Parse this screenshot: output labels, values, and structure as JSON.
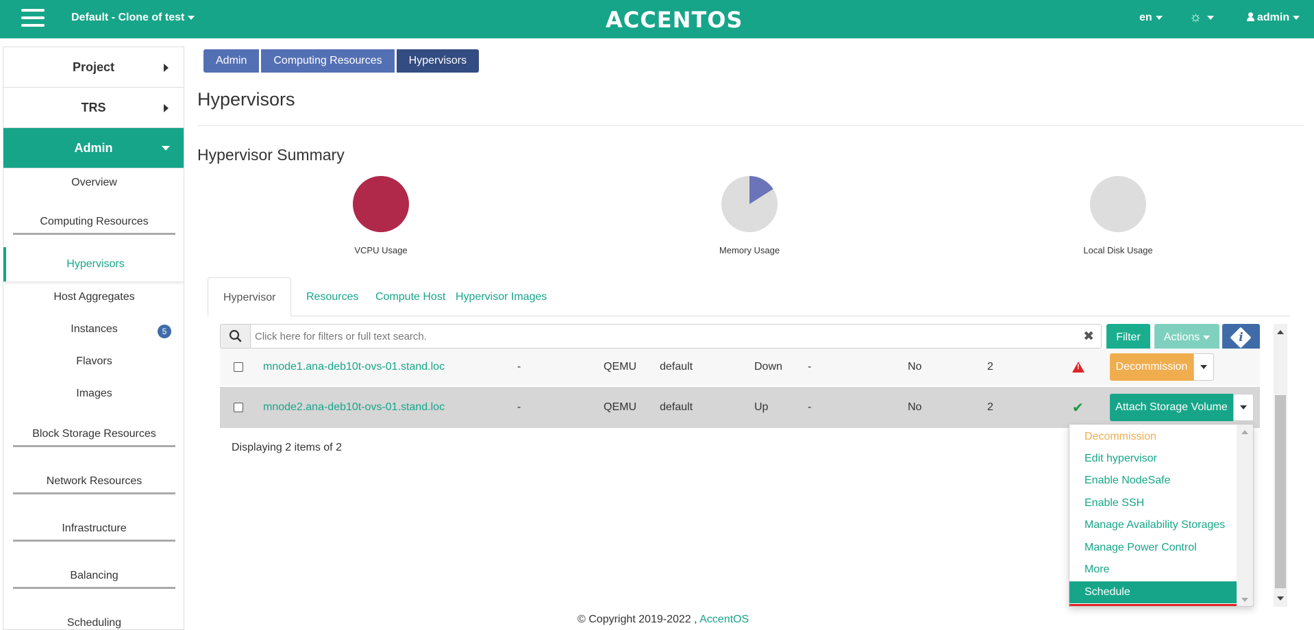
{
  "header": {
    "project": "Default - Clone of test",
    "logo": "ACCENTOS",
    "language": "en",
    "theme_icon": "sun-icon",
    "user": "admin"
  },
  "sidebar": {
    "sections": [
      {
        "label": "Project"
      },
      {
        "label": "TRS"
      },
      {
        "label": "Admin"
      }
    ],
    "items": [
      {
        "label": "Overview"
      },
      {
        "label": "Computing Resources"
      },
      {
        "label": "Hypervisors"
      },
      {
        "label": "Host Aggregates"
      },
      {
        "label": "Instances",
        "badge": "5"
      },
      {
        "label": "Flavors"
      },
      {
        "label": "Images"
      },
      {
        "label": "Block Storage Resources"
      },
      {
        "label": "Network Resources"
      },
      {
        "label": "Infrastructure"
      },
      {
        "label": "Balancing"
      },
      {
        "label": "Scheduling"
      }
    ]
  },
  "breadcrumb": [
    "Admin",
    "Computing Resources",
    "Hypervisors"
  ],
  "page_title": "Hypervisors",
  "summary": {
    "title": "Hypervisor Summary",
    "charts": [
      {
        "label": "VCPU Usage",
        "used_fraction": 1.0,
        "color": "#b0284a"
      },
      {
        "label": "Memory Usage",
        "used_fraction": 0.16,
        "color": "#6b74b8"
      },
      {
        "label": "Local Disk Usage",
        "used_fraction": 0.0,
        "color": "#dddddd"
      }
    ]
  },
  "tabs": [
    "Hypervisor",
    "Resources",
    "Compute Host",
    "Hypervisor Images"
  ],
  "search": {
    "placeholder": "Click here for filters or full text search."
  },
  "buttons": {
    "filter": "Filter",
    "actions": "Actions"
  },
  "table": {
    "rows": [
      {
        "hostname": "mnode1.ana-deb10t-ovs-01.stand.loc",
        "col2": "-",
        "type": "QEMU",
        "zone": "default",
        "state": "Down",
        "col6": "-",
        "col7": "No",
        "col8": "2",
        "status_icon": "warning-icon",
        "action": "Decommission"
      },
      {
        "hostname": "mnode2.ana-deb10t-ovs-01.stand.loc",
        "col2": "-",
        "type": "QEMU",
        "zone": "default",
        "state": "Up",
        "col6": "-",
        "col7": "No",
        "col8": "2",
        "status_icon": "check-icon",
        "action": "Attach Storage Volume"
      }
    ],
    "footer": "Displaying 2 items of 2"
  },
  "dropdown": {
    "items": [
      "Decommission",
      "Edit hypervisor",
      "Enable NodeSafe",
      "Enable SSH",
      "Manage Availability Storages",
      "Manage Power Control",
      "More",
      "Schedule"
    ]
  },
  "footer": {
    "copyright": "© Copyright 2019-2022 ,",
    "link": "AccentOS"
  },
  "colors": {
    "brand": "#17a589",
    "breadcrumb": "#5470b4",
    "warning": "#f0ad4e",
    "danger": "#e02424"
  }
}
